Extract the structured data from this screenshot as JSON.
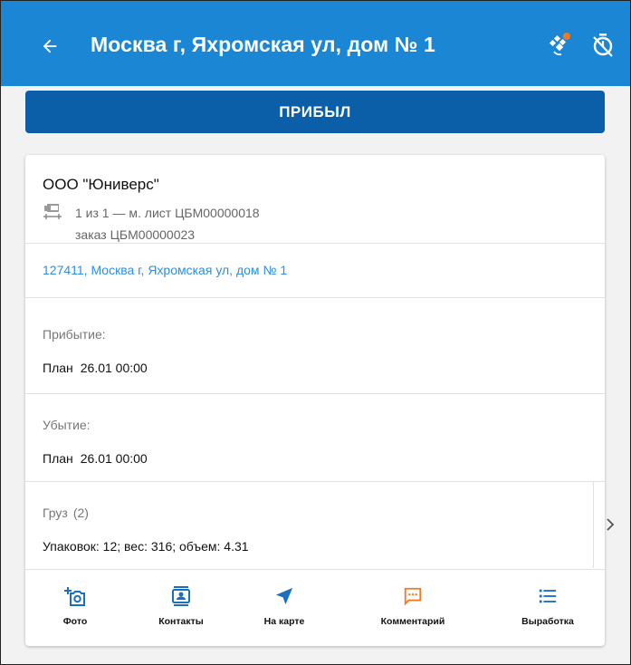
{
  "header": {
    "title": "Москва г, Яхромская ул, дом № 1",
    "back_icon": "arrow-back-icon",
    "gps_icon": "gps-satellite-icon",
    "timer_icon": "timer-off-icon",
    "bg_color": "#1a86d4"
  },
  "arrived_button": {
    "label": "ПРИБЫЛ",
    "color": "#0a5fa8"
  },
  "card": {
    "company": "ООО \"Юниверс\"",
    "route_icon": "route-sheet-icon",
    "route_line": "1 из 1 — м. лист ЦБМ00000018",
    "order_line": "заказ ЦБМ00000023",
    "address": "127411, Москва г, Яхромская ул, дом № 1",
    "arrival": {
      "label": "Прибытие:",
      "plan_label": "План",
      "plan_value": "26.01 00:00"
    },
    "departure": {
      "label": "Убытие:",
      "plan_label": "План",
      "plan_value": "26.01 00:00"
    },
    "cargo": {
      "label": "Груз",
      "count": "(2)",
      "info": "Упаковок: 12; вес: 316; объем: 4.31"
    }
  },
  "actions": [
    {
      "label": "Фото",
      "icon": "add-photo-icon",
      "color": "#1a6fc0"
    },
    {
      "label": "Контакты",
      "icon": "contacts-icon",
      "color": "#1a6fc0"
    },
    {
      "label": "На карте",
      "icon": "navigation-arrow-icon",
      "color": "#1a6fc0"
    },
    {
      "label": "Комментарий",
      "icon": "comment-icon",
      "color": "#f07a22"
    },
    {
      "label": "Выработка",
      "icon": "list-icon",
      "color": "#1a6fc0"
    }
  ]
}
